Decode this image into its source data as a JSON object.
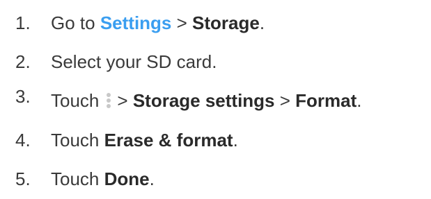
{
  "steps": [
    {
      "number": "1.",
      "parts": {
        "a": "Go to ",
        "b": "Settings",
        "c": " > ",
        "d": "Storage",
        "e": "."
      }
    },
    {
      "number": "2.",
      "parts": {
        "a": "Select your SD card."
      }
    },
    {
      "number": "3.",
      "parts": {
        "a": "Touch",
        "b": "> ",
        "c": "Storage settings",
        "d": " > ",
        "e": "Format",
        "f": "."
      },
      "icon": "more-vert-icon"
    },
    {
      "number": "4.",
      "parts": {
        "a": "Touch ",
        "b": "Erase & format",
        "c": "."
      }
    },
    {
      "number": "5.",
      "parts": {
        "a": "Touch ",
        "b": "Done",
        "c": "."
      }
    }
  ],
  "colors": {
    "text": "#3a3a3a",
    "link": "#3a9ef0",
    "icon": "#c8c8c8"
  }
}
